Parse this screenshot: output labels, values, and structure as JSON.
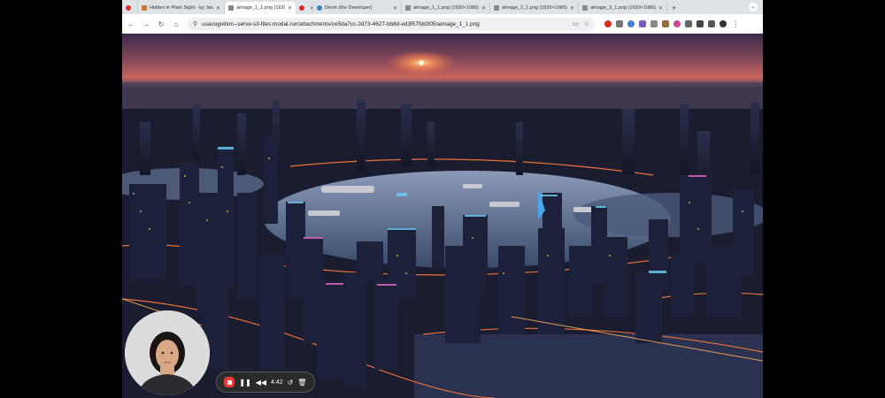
{
  "tabs": [
    {
      "title": "",
      "favicon_color": "#d93025",
      "active": false,
      "closable": false
    },
    {
      "title": "Hidden in Plain Sight - by Jas",
      "favicon_color": "#c67c3e",
      "active": false,
      "closable": true
    },
    {
      "title": "aimage_1_1.png (1920×1080)",
      "favicon_color": "#888888",
      "active": true,
      "closable": true
    },
    {
      "title": "",
      "favicon_color": "#d93025",
      "active": false,
      "closable": true
    },
    {
      "title": "Devin (the Developer)",
      "favicon_color": "#3b82c4",
      "active": false,
      "closable": true
    },
    {
      "title": "aimage_1_1.png (1920×1080)",
      "favicon_color": "#888888",
      "active": false,
      "closable": true
    },
    {
      "title": "aimage_2_1.png (1920×1080)",
      "favicon_color": "#888888",
      "active": false,
      "closable": true
    },
    {
      "title": "aimage_3_1.png (1920×1080)",
      "favicon_color": "#888888",
      "active": false,
      "closable": true
    }
  ],
  "toolbar": {
    "url": "usacognition--serve-s3-files.modal.run/attachments/ce5da7cc-2d73-4627-bb8d-ed3f57fdd305/aimage_1_1.png"
  },
  "extensions": [
    "#d93025",
    "#777777",
    "#4a7fd4",
    "#7a5cc9",
    "#888888",
    "#9a6b3d",
    "#c94a8c",
    "#666666",
    "#444444",
    "#555555",
    "#333333"
  ],
  "page_image": {
    "description_icon": "ai-generated-futuristic-city-image"
  },
  "recorder": {
    "time": "4:42"
  }
}
